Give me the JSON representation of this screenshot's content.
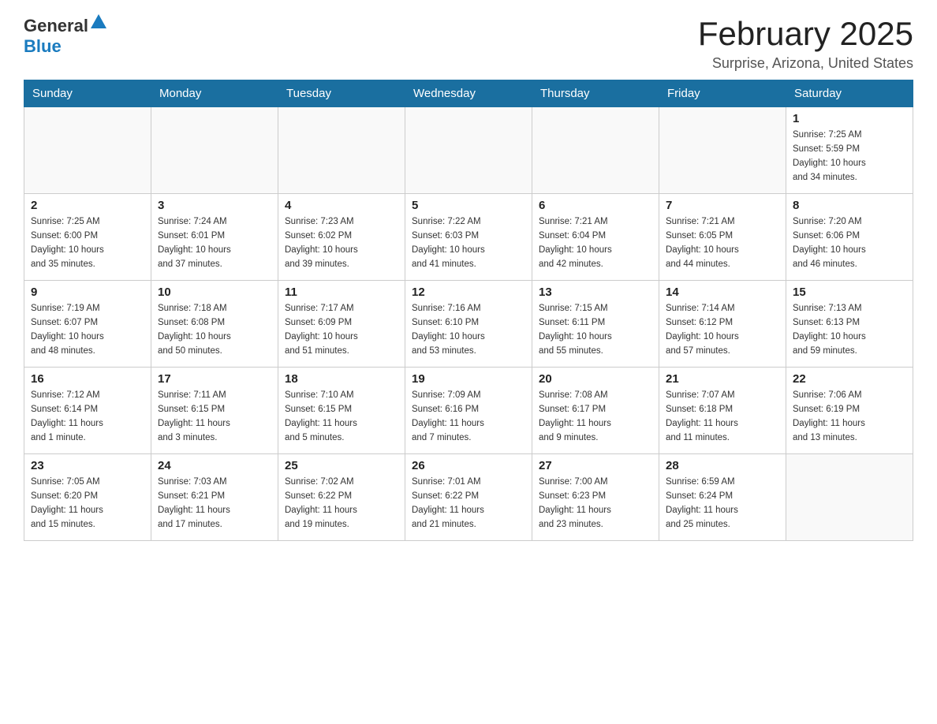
{
  "logo": {
    "general": "General",
    "blue": "Blue"
  },
  "header": {
    "title": "February 2025",
    "location": "Surprise, Arizona, United States"
  },
  "days_of_week": [
    "Sunday",
    "Monday",
    "Tuesday",
    "Wednesday",
    "Thursday",
    "Friday",
    "Saturday"
  ],
  "weeks": [
    [
      {
        "day": "",
        "info": ""
      },
      {
        "day": "",
        "info": ""
      },
      {
        "day": "",
        "info": ""
      },
      {
        "day": "",
        "info": ""
      },
      {
        "day": "",
        "info": ""
      },
      {
        "day": "",
        "info": ""
      },
      {
        "day": "1",
        "info": "Sunrise: 7:25 AM\nSunset: 5:59 PM\nDaylight: 10 hours\nand 34 minutes."
      }
    ],
    [
      {
        "day": "2",
        "info": "Sunrise: 7:25 AM\nSunset: 6:00 PM\nDaylight: 10 hours\nand 35 minutes."
      },
      {
        "day": "3",
        "info": "Sunrise: 7:24 AM\nSunset: 6:01 PM\nDaylight: 10 hours\nand 37 minutes."
      },
      {
        "day": "4",
        "info": "Sunrise: 7:23 AM\nSunset: 6:02 PM\nDaylight: 10 hours\nand 39 minutes."
      },
      {
        "day": "5",
        "info": "Sunrise: 7:22 AM\nSunset: 6:03 PM\nDaylight: 10 hours\nand 41 minutes."
      },
      {
        "day": "6",
        "info": "Sunrise: 7:21 AM\nSunset: 6:04 PM\nDaylight: 10 hours\nand 42 minutes."
      },
      {
        "day": "7",
        "info": "Sunrise: 7:21 AM\nSunset: 6:05 PM\nDaylight: 10 hours\nand 44 minutes."
      },
      {
        "day": "8",
        "info": "Sunrise: 7:20 AM\nSunset: 6:06 PM\nDaylight: 10 hours\nand 46 minutes."
      }
    ],
    [
      {
        "day": "9",
        "info": "Sunrise: 7:19 AM\nSunset: 6:07 PM\nDaylight: 10 hours\nand 48 minutes."
      },
      {
        "day": "10",
        "info": "Sunrise: 7:18 AM\nSunset: 6:08 PM\nDaylight: 10 hours\nand 50 minutes."
      },
      {
        "day": "11",
        "info": "Sunrise: 7:17 AM\nSunset: 6:09 PM\nDaylight: 10 hours\nand 51 minutes."
      },
      {
        "day": "12",
        "info": "Sunrise: 7:16 AM\nSunset: 6:10 PM\nDaylight: 10 hours\nand 53 minutes."
      },
      {
        "day": "13",
        "info": "Sunrise: 7:15 AM\nSunset: 6:11 PM\nDaylight: 10 hours\nand 55 minutes."
      },
      {
        "day": "14",
        "info": "Sunrise: 7:14 AM\nSunset: 6:12 PM\nDaylight: 10 hours\nand 57 minutes."
      },
      {
        "day": "15",
        "info": "Sunrise: 7:13 AM\nSunset: 6:13 PM\nDaylight: 10 hours\nand 59 minutes."
      }
    ],
    [
      {
        "day": "16",
        "info": "Sunrise: 7:12 AM\nSunset: 6:14 PM\nDaylight: 11 hours\nand 1 minute."
      },
      {
        "day": "17",
        "info": "Sunrise: 7:11 AM\nSunset: 6:15 PM\nDaylight: 11 hours\nand 3 minutes."
      },
      {
        "day": "18",
        "info": "Sunrise: 7:10 AM\nSunset: 6:15 PM\nDaylight: 11 hours\nand 5 minutes."
      },
      {
        "day": "19",
        "info": "Sunrise: 7:09 AM\nSunset: 6:16 PM\nDaylight: 11 hours\nand 7 minutes."
      },
      {
        "day": "20",
        "info": "Sunrise: 7:08 AM\nSunset: 6:17 PM\nDaylight: 11 hours\nand 9 minutes."
      },
      {
        "day": "21",
        "info": "Sunrise: 7:07 AM\nSunset: 6:18 PM\nDaylight: 11 hours\nand 11 minutes."
      },
      {
        "day": "22",
        "info": "Sunrise: 7:06 AM\nSunset: 6:19 PM\nDaylight: 11 hours\nand 13 minutes."
      }
    ],
    [
      {
        "day": "23",
        "info": "Sunrise: 7:05 AM\nSunset: 6:20 PM\nDaylight: 11 hours\nand 15 minutes."
      },
      {
        "day": "24",
        "info": "Sunrise: 7:03 AM\nSunset: 6:21 PM\nDaylight: 11 hours\nand 17 minutes."
      },
      {
        "day": "25",
        "info": "Sunrise: 7:02 AM\nSunset: 6:22 PM\nDaylight: 11 hours\nand 19 minutes."
      },
      {
        "day": "26",
        "info": "Sunrise: 7:01 AM\nSunset: 6:22 PM\nDaylight: 11 hours\nand 21 minutes."
      },
      {
        "day": "27",
        "info": "Sunrise: 7:00 AM\nSunset: 6:23 PM\nDaylight: 11 hours\nand 23 minutes."
      },
      {
        "day": "28",
        "info": "Sunrise: 6:59 AM\nSunset: 6:24 PM\nDaylight: 11 hours\nand 25 minutes."
      },
      {
        "day": "",
        "info": ""
      }
    ]
  ]
}
